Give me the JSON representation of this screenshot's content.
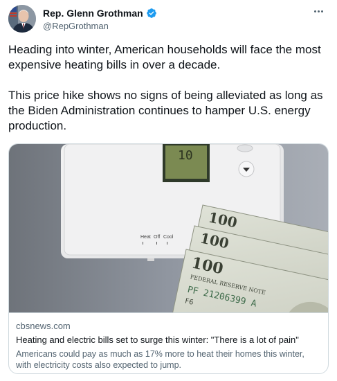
{
  "author": {
    "display_name": "Rep. Glenn Grothman",
    "handle": "@RepGrothman",
    "verified": true,
    "accent_color": "#1d9bf0"
  },
  "tweet": {
    "paragraphs": [
      "Heading into winter, American households will face the most expensive heating bills in over a decade.",
      "This price hike shows no signs of being alleviated as long as the Biden Administration continues to hamper U.S. energy production."
    ]
  },
  "card": {
    "image": {
      "thermostat_display": "10",
      "thermostat_labels": [
        "Heat",
        "Off",
        "Cool"
      ],
      "bill_denomination": "100",
      "bill_note_text": "FEDERAL RESERVE NOTE",
      "bill_serial": "PF 21206399 A",
      "bill_code": "F6"
    },
    "domain": "cbsnews.com",
    "title": "Heating and electric bills set to surge this winter: \"There is a lot of pain\"",
    "description": "Americans could pay as much as 17% more to heat their homes this winter, with electricity costs also expected to jump."
  },
  "icons": {
    "verified": "verified-badge-icon",
    "more": "more-options-icon"
  }
}
